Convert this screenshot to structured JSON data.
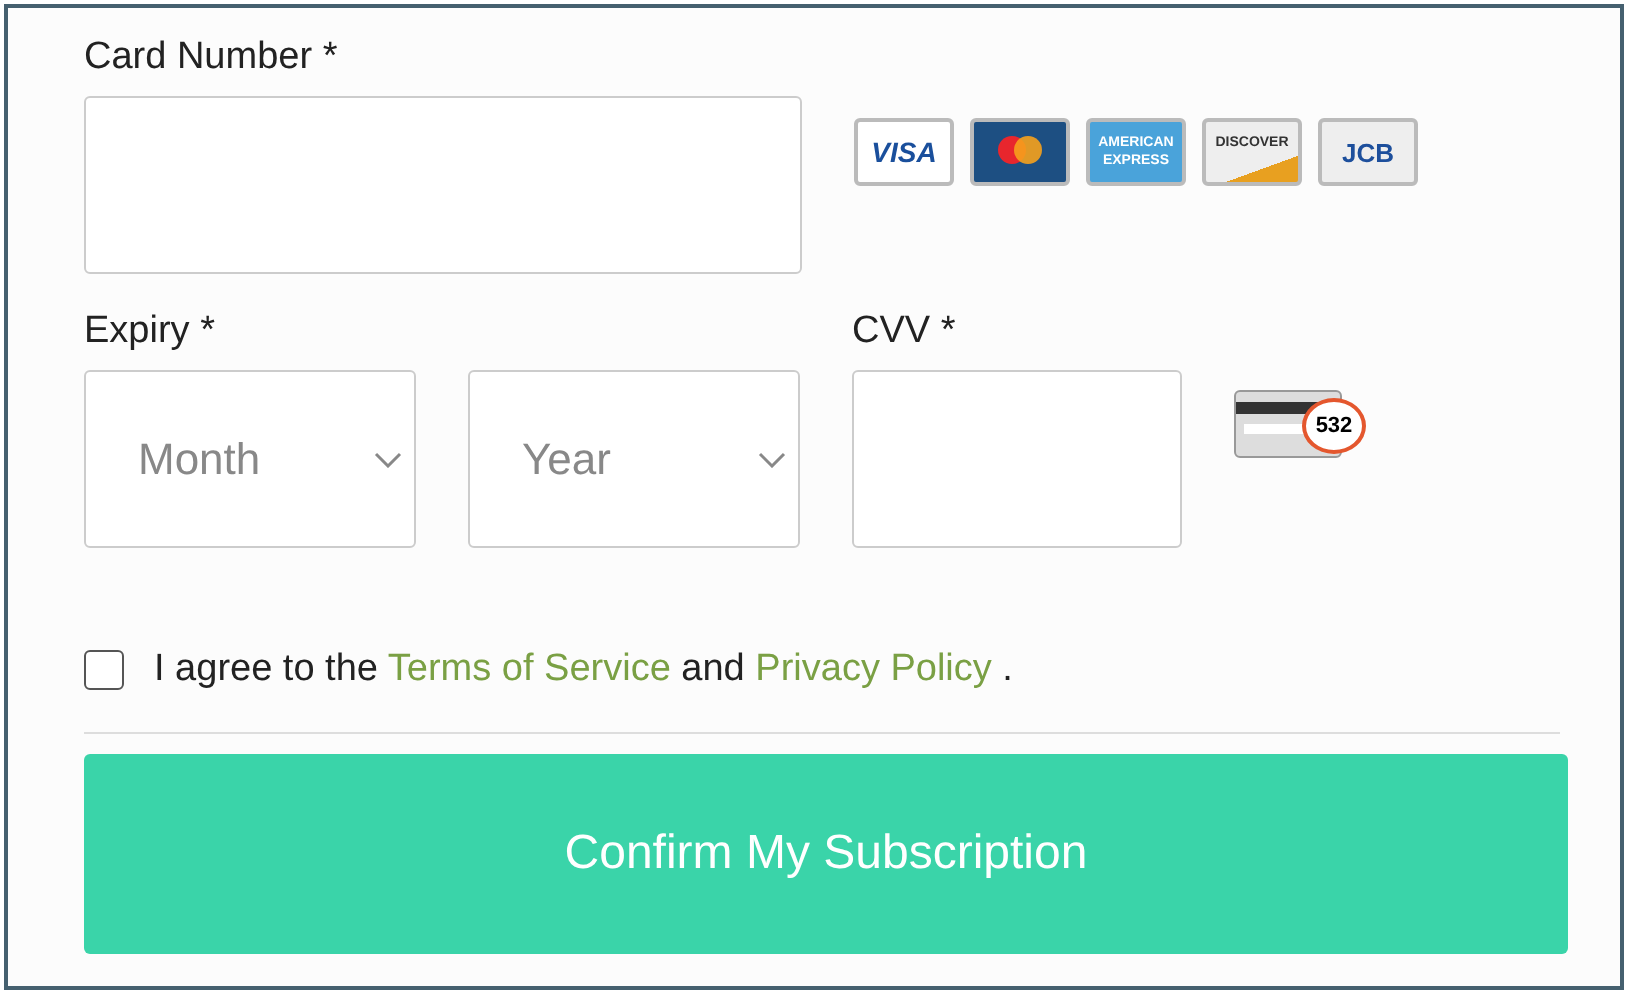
{
  "card_number": {
    "label": "Card Number *"
  },
  "card_logos": [
    {
      "kind": "visa",
      "text": "VISA"
    },
    {
      "kind": "mastercard"
    },
    {
      "kind": "amex",
      "text": "AMERICAN EXPRESS"
    },
    {
      "kind": "discover",
      "text": "DISCOVER"
    },
    {
      "kind": "jcb",
      "text": "JCB"
    }
  ],
  "expiry": {
    "label": "Expiry *",
    "month_placeholder": "Month",
    "year_placeholder": "Year"
  },
  "cvv": {
    "label": "CVV *",
    "hint_code": "532"
  },
  "agreement": {
    "checked": false,
    "before": "I agree to the",
    "terms_link": "Terms of Service",
    "middle": "and",
    "privacy_link": "Privacy Policy",
    "after": "."
  },
  "submit_button": "Confirm My Subscription"
}
